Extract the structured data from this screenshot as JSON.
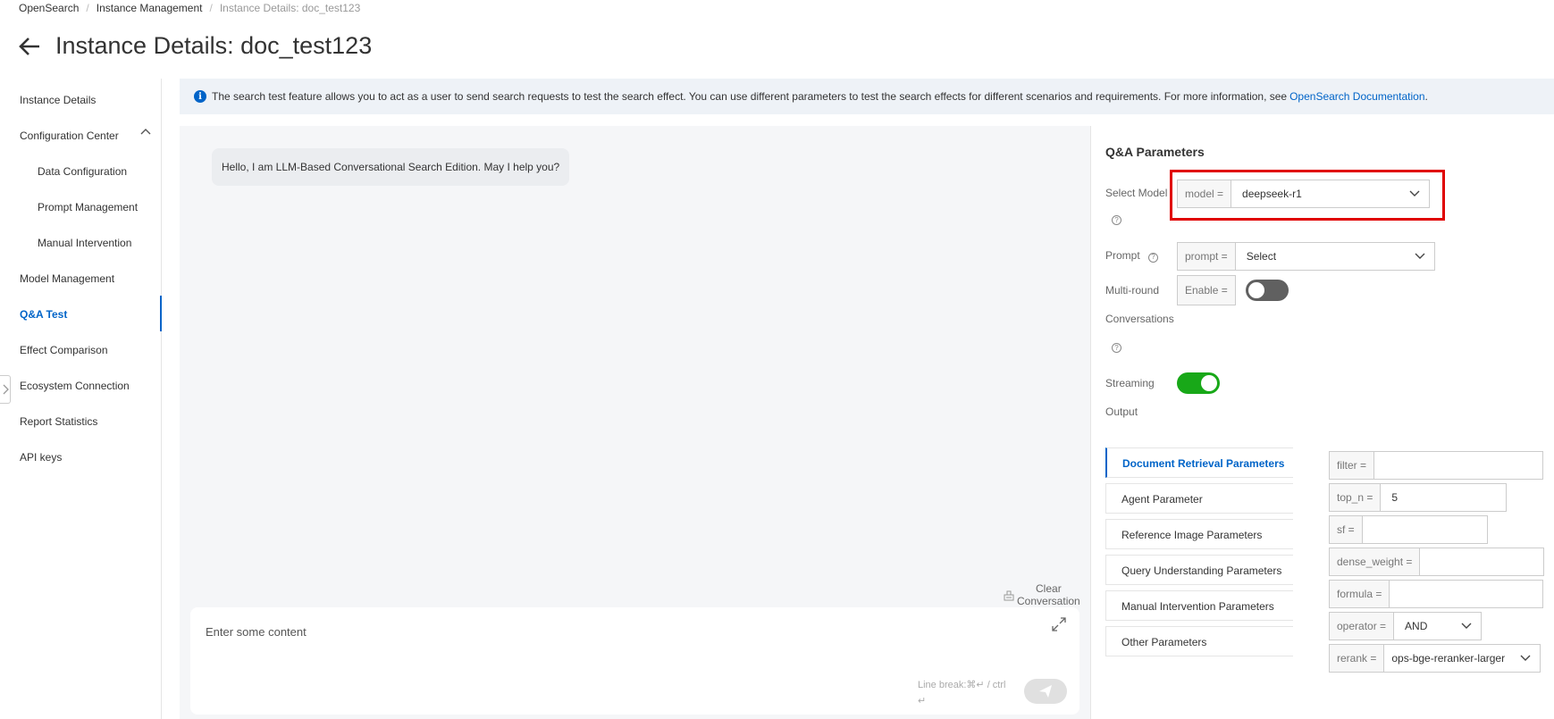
{
  "breadcrumb": {
    "items": [
      "OpenSearch",
      "Instance Management"
    ],
    "current": "Instance Details: doc_test123"
  },
  "page_title": "Instance Details: doc_test123",
  "sidebar": {
    "items": [
      {
        "label": "Instance Details"
      },
      {
        "label": "Configuration Center"
      },
      {
        "label": "Data Configuration"
      },
      {
        "label": "Prompt Management"
      },
      {
        "label": "Manual Intervention"
      },
      {
        "label": "Model Management"
      },
      {
        "label": "Q&A Test",
        "active": true
      },
      {
        "label": "Effect Comparison"
      },
      {
        "label": "Ecosystem Connection"
      },
      {
        "label": "Report Statistics"
      },
      {
        "label": "API keys"
      }
    ]
  },
  "info_bar": {
    "text": "The search test feature allows you to act as a user to send search requests to test the search effect. You can use different parameters to test the search effects for different scenarios and requirements. For more information, see",
    "link": "OpenSearch Documentation",
    "end": "."
  },
  "chat": {
    "greeting": "Hello, I am LLM-Based Conversational Search Edition. May I help you?",
    "clear_line1": "Clear",
    "clear_line2": "Conversation",
    "input_placeholder": "Enter some content",
    "hint_line1": "Line break:⌘↵ / ctrl",
    "hint_line2": "↵"
  },
  "params": {
    "title": "Q&A Parameters",
    "select_model_label": "Select Model",
    "model_addon": "model =",
    "model_value": "deepseek-r1",
    "prompt_label": "Prompt",
    "prompt_addon": "prompt =",
    "prompt_value": "Select",
    "multiround_label1": "Multi-round",
    "multiround_label2": "Conversations",
    "enable_addon": "Enable =",
    "multiround_enabled": false,
    "streaming_label1": "Streaming",
    "streaming_label2": "Output",
    "streaming_enabled": true,
    "tabs": [
      {
        "label": "Document Retrieval Parameters",
        "active": true
      },
      {
        "label": "Agent Parameter"
      },
      {
        "label": "Reference Image Parameters"
      },
      {
        "label": "Query Understanding Parameters"
      },
      {
        "label": "Manual Intervention Parameters"
      },
      {
        "label": "Other Parameters"
      }
    ],
    "fields": {
      "filter": {
        "addon": "filter =",
        "value": ""
      },
      "top_n": {
        "addon": "top_n =",
        "value": "5"
      },
      "sf": {
        "addon": "sf =",
        "value": ""
      },
      "dense_weight": {
        "addon": "dense_weight =",
        "value": ""
      },
      "formula": {
        "addon": "formula =",
        "value": ""
      },
      "operator": {
        "addon": "operator =",
        "value": "AND"
      },
      "rerank": {
        "addon": "rerank =",
        "value": "ops-bge-reranker-larger"
      }
    }
  },
  "colors": {
    "accent": "#0064c8",
    "toggle_on": "#18a818",
    "toggle_off": "#606060",
    "highlight": "#e00000"
  }
}
